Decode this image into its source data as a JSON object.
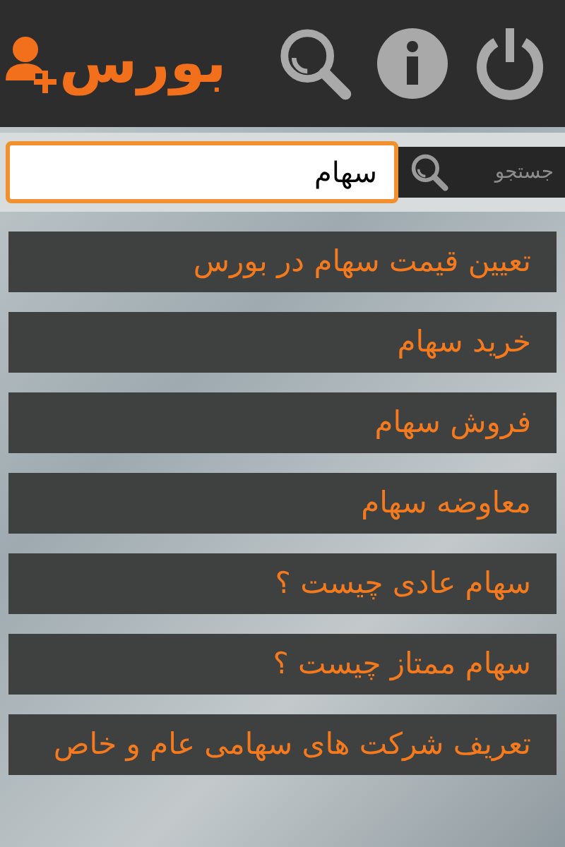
{
  "header": {
    "logo": "بورس"
  },
  "search": {
    "label": "جستجو",
    "value": "سهام"
  },
  "items": [
    "تعیین قیمت سهام در بورس",
    "خرید سهام",
    "فروش سهام",
    "معاوضه سهام",
    "سهام عادی چیست ؟",
    "سهام ممتاز چیست ؟",
    "تعریف شرکت های سهامی عام و خاص"
  ]
}
